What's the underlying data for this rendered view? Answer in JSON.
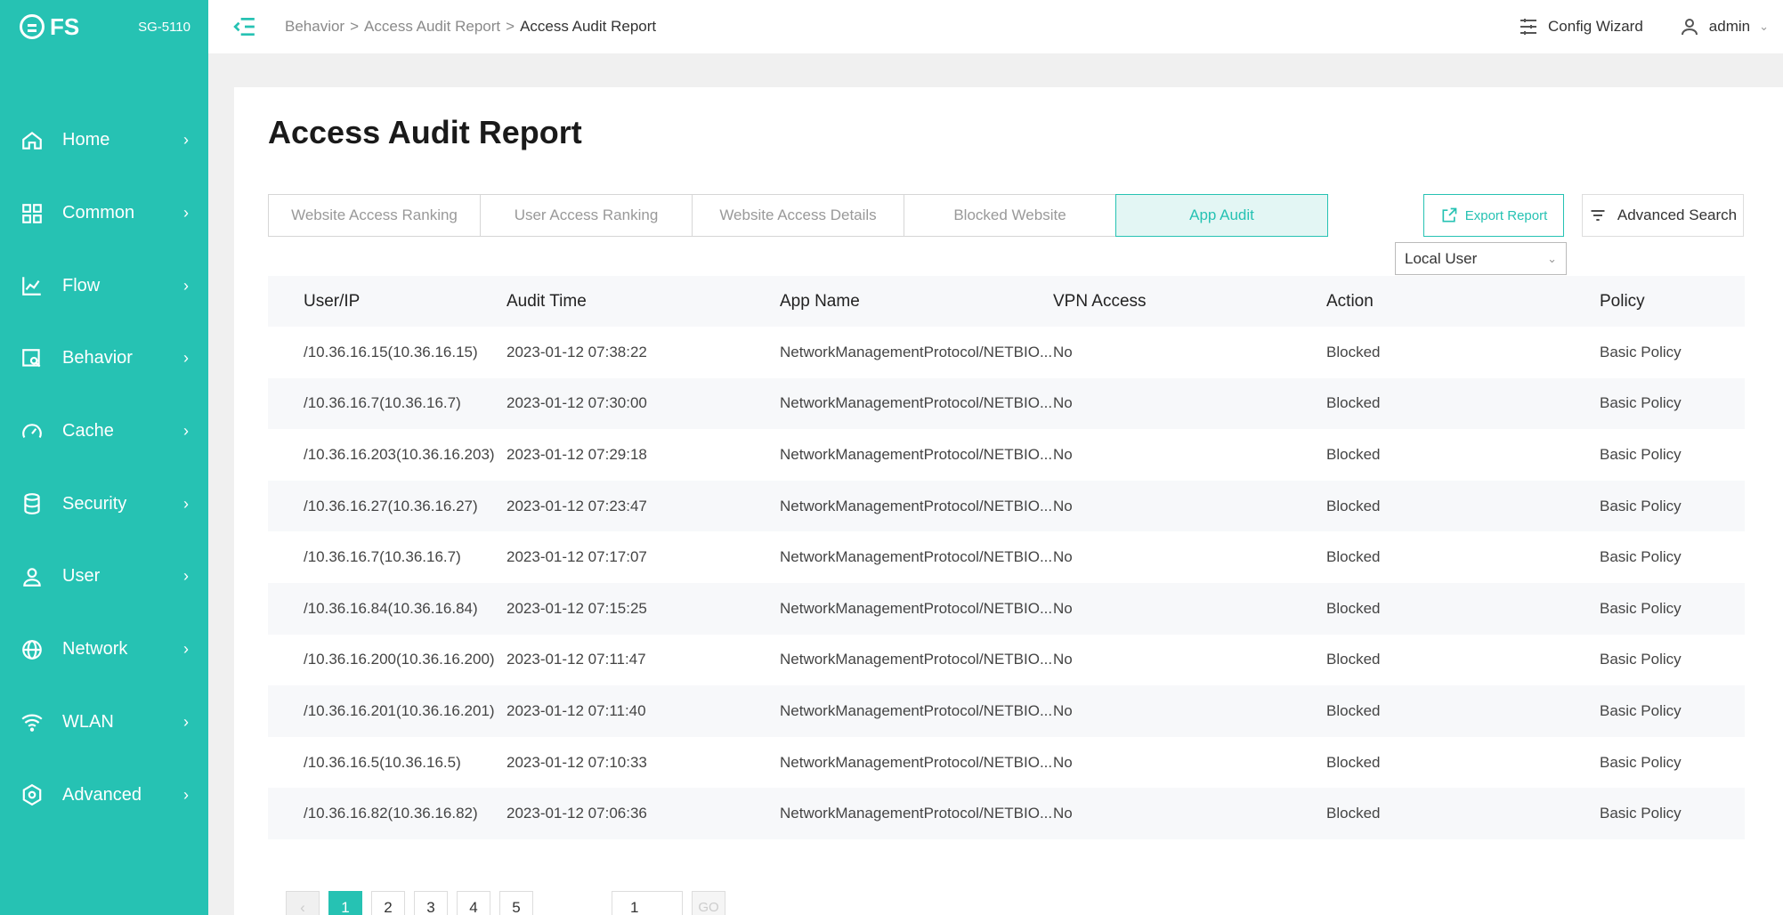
{
  "brand": {
    "logo": "FS",
    "model": "SG-5110"
  },
  "sidebar": {
    "items": [
      {
        "label": "Home",
        "icon": "home-icon"
      },
      {
        "label": "Common",
        "icon": "grid-icon"
      },
      {
        "label": "Flow",
        "icon": "chart-icon"
      },
      {
        "label": "Behavior",
        "icon": "audit-icon"
      },
      {
        "label": "Cache",
        "icon": "gauge-icon"
      },
      {
        "label": "Security",
        "icon": "database-icon"
      },
      {
        "label": "User",
        "icon": "user-icon"
      },
      {
        "label": "Network",
        "icon": "globe-icon"
      },
      {
        "label": "WLAN",
        "icon": "wifi-icon"
      },
      {
        "label": "Advanced",
        "icon": "settings-icon"
      }
    ]
  },
  "header": {
    "breadcrumb": {
      "level1": "Behavior",
      "sep1": ">",
      "level2": "Access Audit Report",
      "sep2": ">",
      "current": "Access Audit Report"
    },
    "config_wizard": "Config Wizard",
    "user": "admin"
  },
  "main": {
    "title": "Access Audit Report",
    "tabs": [
      {
        "label": "Website Access Ranking"
      },
      {
        "label": "User Access Ranking"
      },
      {
        "label": "Website Access Details"
      },
      {
        "label": "Blocked Website"
      },
      {
        "label": "App Audit"
      }
    ],
    "export_label": "Export Report",
    "advanced_search_label": "Advanced Search",
    "user_filter": "Local User",
    "table": {
      "headers": [
        "User/IP",
        "Audit Time",
        "App Name",
        "VPN Access",
        "Action",
        "Policy"
      ],
      "rows": [
        [
          "/10.36.16.15(10.36.16.15)",
          "2023-01-12 07:38:22",
          "NetworkManagementProtocol/NETBIO...",
          "No",
          "Blocked",
          "Basic Policy"
        ],
        [
          "/10.36.16.7(10.36.16.7)",
          "2023-01-12 07:30:00",
          "NetworkManagementProtocol/NETBIO...",
          "No",
          "Blocked",
          "Basic Policy"
        ],
        [
          "/10.36.16.203(10.36.16.203)",
          "2023-01-12 07:29:18",
          "NetworkManagementProtocol/NETBIO...",
          "No",
          "Blocked",
          "Basic Policy"
        ],
        [
          "/10.36.16.27(10.36.16.27)",
          "2023-01-12 07:23:47",
          "NetworkManagementProtocol/NETBIO...",
          "No",
          "Blocked",
          "Basic Policy"
        ],
        [
          "/10.36.16.7(10.36.16.7)",
          "2023-01-12 07:17:07",
          "NetworkManagementProtocol/NETBIO...",
          "No",
          "Blocked",
          "Basic Policy"
        ],
        [
          "/10.36.16.84(10.36.16.84)",
          "2023-01-12 07:15:25",
          "NetworkManagementProtocol/NETBIO...",
          "No",
          "Blocked",
          "Basic Policy"
        ],
        [
          "/10.36.16.200(10.36.16.200)",
          "2023-01-12 07:11:47",
          "NetworkManagementProtocol/NETBIO...",
          "No",
          "Blocked",
          "Basic Policy"
        ],
        [
          "/10.36.16.201(10.36.16.201)",
          "2023-01-12 07:11:40",
          "NetworkManagementProtocol/NETBIO...",
          "No",
          "Blocked",
          "Basic Policy"
        ],
        [
          "/10.36.16.5(10.36.16.5)",
          "2023-01-12 07:10:33",
          "NetworkManagementProtocol/NETBIO...",
          "No",
          "Blocked",
          "Basic Policy"
        ],
        [
          "/10.36.16.82(10.36.16.82)",
          "2023-01-12 07:06:36",
          "NetworkManagementProtocol/NETBIO...",
          "No",
          "Blocked",
          "Basic Policy"
        ]
      ]
    },
    "pagination": {
      "prev": "‹",
      "pages": [
        "1",
        "2",
        "3",
        "4",
        "5"
      ],
      "next": "›",
      "jump_value": "1",
      "go_label": "GO"
    }
  },
  "colors": {
    "accent": "#26c2b3",
    "sidebar_bg": "#26c2b3",
    "row_alt": "#f7f8fa"
  }
}
